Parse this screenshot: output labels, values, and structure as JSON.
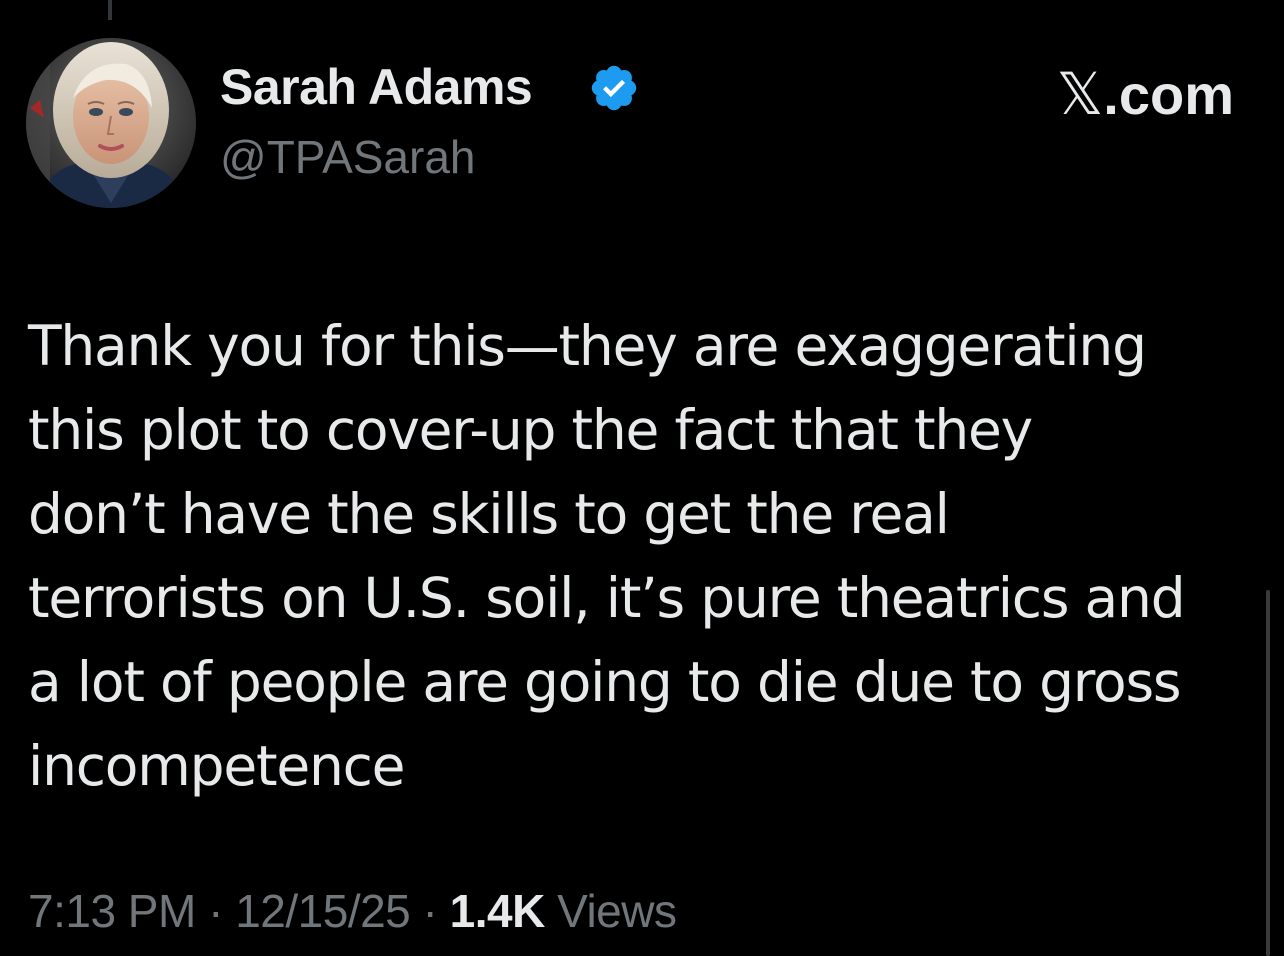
{
  "author": {
    "display_name": "Sarah Adams",
    "handle": "@TPASarah",
    "verified_icon": "verified-badge-icon",
    "badge_color": "#1d9bf0"
  },
  "brand": {
    "x_glyph": "𝕏",
    "suffix": ".com"
  },
  "tweet": {
    "lines": [
      "Thank you for this—they are exaggerating",
      "this plot to cover-up the fact that they",
      "don’t have the skills to get the real",
      "terrorists on U.S. soil, it’s pure theatrics and",
      "a lot of people are going to die due to gross",
      "incompetence"
    ]
  },
  "meta": {
    "time": "7:13 PM",
    "separator": " · ",
    "date": "12/15/25",
    "views_count": "1.4K",
    "views_label": " Views"
  },
  "colors": {
    "background": "#000000",
    "text": "#e7e9ea",
    "secondary_text": "#71767b"
  }
}
